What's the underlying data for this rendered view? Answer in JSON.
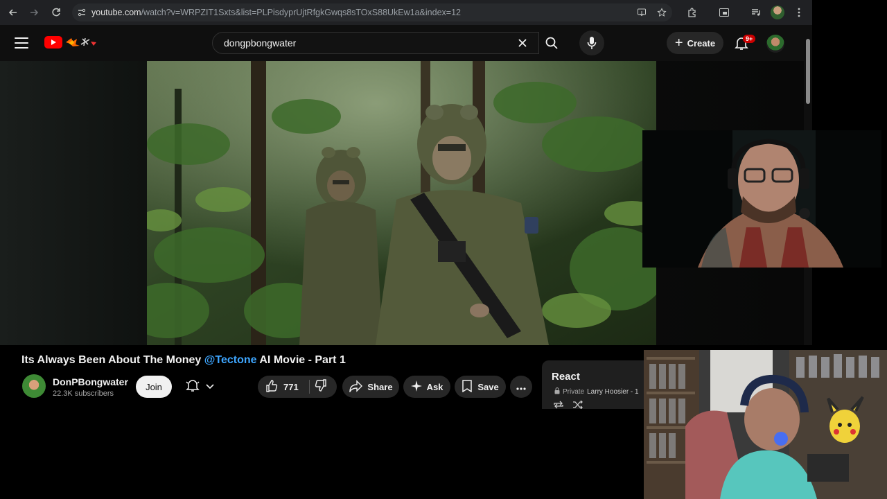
{
  "browser": {
    "url_host": "youtube.com",
    "url_path": "/watch?v=WRPZIT1Sxts&list=PLPisdyprUjtRfgkGwqs8sTOxS88UkEw1a&index=12"
  },
  "masthead": {
    "search_value": "dongpbongwater",
    "create_label": "Create",
    "notification_count": "9+"
  },
  "video": {
    "title_prefix": "Its Always Been About The Money ",
    "title_mention": "@Tectone",
    "title_suffix": " AI Movie - Part 1"
  },
  "channel": {
    "name": "DonPBongwater",
    "subscribers": "22.3K subscribers",
    "join_label": "Join"
  },
  "actions": {
    "like_count": "771",
    "share_label": "Share",
    "ask_label": "Ask",
    "save_label": "Save"
  },
  "react_panel": {
    "title": "React",
    "privacy": "Private",
    "owner": "Larry Hoosier - 1"
  },
  "colors": {
    "background": "#0f0f0f",
    "mention": "#3ea6ff",
    "logo_red": "#ff0000",
    "badge": "#cc0000"
  }
}
